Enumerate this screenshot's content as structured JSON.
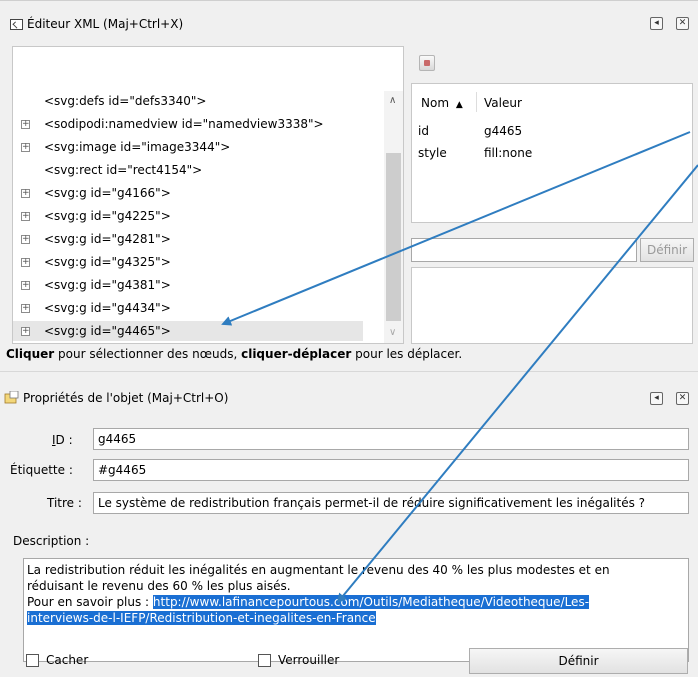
{
  "xml_editor": {
    "title": "Éditeur XML (Maj+Ctrl+X)",
    "nodes": [
      {
        "text": "<svg:defs id=\"defs3340\">",
        "expandable": false
      },
      {
        "text": "<sodipodi:namedview id=\"namedview3338\">",
        "expandable": true
      },
      {
        "text": "<svg:image id=\"image3344\">",
        "expandable": true
      },
      {
        "text": "<svg:rect id=\"rect4154\">",
        "expandable": false
      },
      {
        "text": "<svg:g id=\"g4166\">",
        "expandable": true
      },
      {
        "text": "<svg:g id=\"g4225\">",
        "expandable": true
      },
      {
        "text": "<svg:g id=\"g4281\">",
        "expandable": true
      },
      {
        "text": "<svg:g id=\"g4325\">",
        "expandable": true
      },
      {
        "text": "<svg:g id=\"g4381\">",
        "expandable": true
      },
      {
        "text": "<svg:g id=\"g4434\">",
        "expandable": true
      },
      {
        "text": "<svg:g id=\"g4465\">",
        "expandable": true,
        "selected": true
      }
    ],
    "attr_headers": {
      "name": "Nom",
      "sort_glyph": "▲",
      "value": "Valeur"
    },
    "attributes": [
      {
        "name": "id",
        "value": "g4465"
      },
      {
        "name": "style",
        "value": "fill:none"
      }
    ],
    "set_label": "Définir",
    "hint_prefix_bold": "Cliquer",
    "hint_mid": " pour sélectionner des nœuds, ",
    "hint_bold2": "cliquer-déplacer",
    "hint_suffix": " pour les déplacer."
  },
  "object_props": {
    "title": "Propriétés de l'objet (Maj+Ctrl+O)",
    "id_label": "ID :",
    "id_value": "g4465",
    "label_label": "Étiquette :",
    "label_value": "#g4465",
    "title_label": "Titre :",
    "title_value": "Le système de redistribution français permet-il de réduire significativement les inégalités ?",
    "description_label": "Description :",
    "description_line1": "La redistribution réduit les inégalités en augmentant le revenu des 40 % les plus modestes et en",
    "description_line2": "réduisant le revenu des 60 % les plus aisés.",
    "description_line3_prefix": "Pour en savoir plus : ",
    "description_link_part1": "http://www.lafinancepourtous.com/Outils/Mediatheque/Videotheque/Les-",
    "description_link_part2": "interviews-de-l-IEFP/Redistribution-et-inegalites-en-France",
    "hide_label": "Cacher",
    "lock_label": "Verrouiller",
    "set_label": "Définir"
  },
  "colors": {
    "selection": "#1a6fd3",
    "arrow": "#2f7dc0",
    "window_bg": "#f0f0f0"
  }
}
